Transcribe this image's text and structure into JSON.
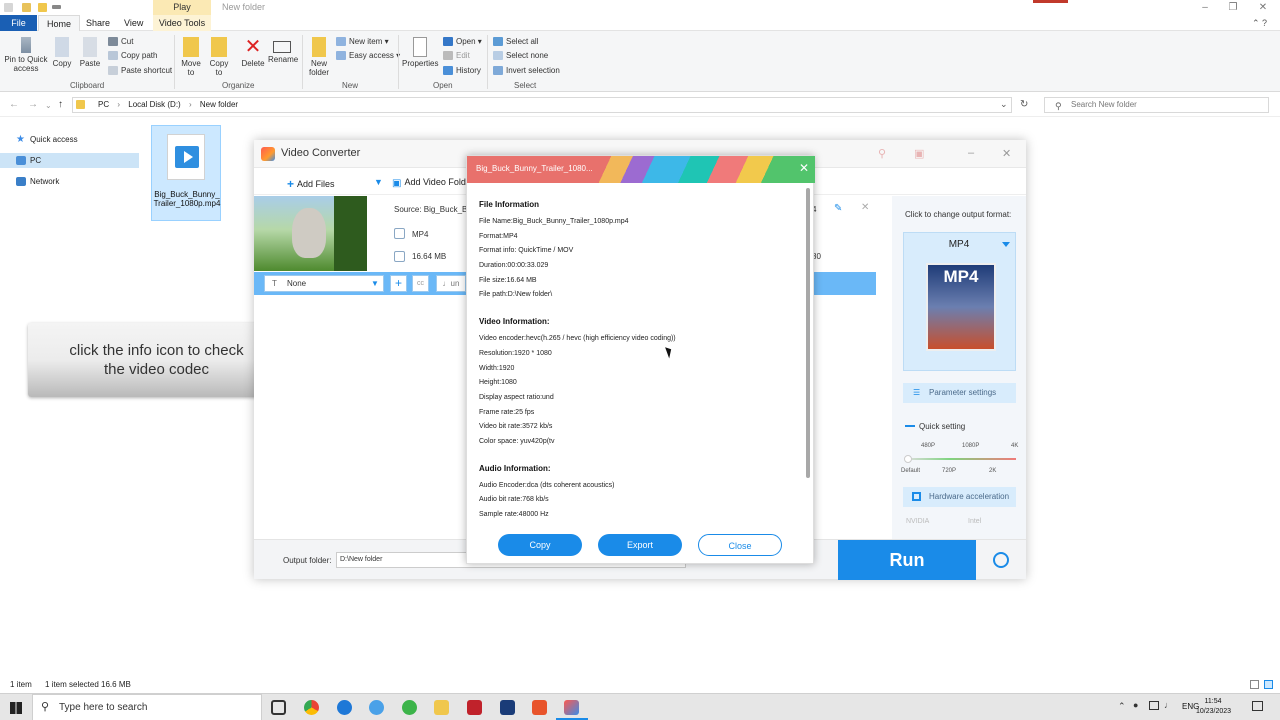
{
  "explorer": {
    "context_tab": "Play",
    "title": "New folder",
    "tabs": [
      "File",
      "Home",
      "Share",
      "View",
      "Video Tools"
    ],
    "ribbon": {
      "pin": "Pin to Quick access",
      "copy": "Copy",
      "paste": "Paste",
      "cut": "Cut",
      "copy_path": "Copy path",
      "paste_shortcut": "Paste shortcut",
      "move_to": "Move to",
      "copy_to": "Copy to",
      "delete": "Delete",
      "rename": "Rename",
      "new_folder": "New folder",
      "new_item": "New item",
      "easy_access": "Easy access",
      "properties": "Properties",
      "open": "Open",
      "edit": "Edit",
      "history": "History",
      "select_all": "Select all",
      "select_none": "Select none",
      "invert_selection": "Invert selection",
      "groups": [
        "Clipboard",
        "Organize",
        "New",
        "Open",
        "Select"
      ]
    },
    "breadcrumb": [
      "PC",
      "Local Disk (D:)",
      "New folder"
    ],
    "search_placeholder": "Search New folder",
    "nav": [
      "Quick access",
      "PC",
      "Network"
    ],
    "file_name": "Big_Buck_Bunny_Trailer_1080p.mp4",
    "status": {
      "count": "1 item",
      "selected": "1 item selected  16.6 MB"
    }
  },
  "taskbar": {
    "search_placeholder": "Type here to search",
    "lang": "ENG",
    "time": "11:54",
    "date": "10/23/2023"
  },
  "converter": {
    "title": "Video Converter",
    "add_files": "Add Files",
    "add_video_folder": "Add Video Fold",
    "source_label": "Source: Big_Buck_B",
    "format": "MP4",
    "size": "16.64 MB",
    "right_clip_1": "4",
    "right_clip_2": "80",
    "subtitle": "None",
    "audio_clip": "un",
    "output_hint": "Click to change output format:",
    "output_format": "MP4",
    "parameter_settings": "Parameter settings",
    "quick_setting": "Quick setting",
    "quality_top": [
      "480P",
      "1080P",
      "4K"
    ],
    "quality_bottom": [
      "Default",
      "720P",
      "2K"
    ],
    "hardware_acceleration": "Hardware acceleration",
    "chips": [
      "NVIDIA",
      "Intel"
    ],
    "output_folder_label": "Output folder:",
    "output_folder_value": "D:\\New folder",
    "run": "Run"
  },
  "dialog": {
    "title": "Big_Buck_Bunny_Trailer_1080...",
    "file_info_heading": "File Information",
    "file_info": [
      "File Name:Big_Buck_Bunny_Trailer_1080p.mp4",
      "Format:MP4",
      "Format info: QuickTime / MOV",
      "Duration:00:00:33.029",
      "File size:16.64 MB",
      "File path:D:\\New folder\\"
    ],
    "video_info_heading": "Video Information:",
    "video_info": [
      "Video encoder:hevc(h.265 / hevc (high efficiency video coding))",
      "Resolution:1920 * 1080",
      "Width:1920",
      "Height:1080",
      "Display aspect ratio:und",
      "Frame rate:25 fps",
      "Video bit rate:3572 kb/s",
      "Color space: yuv420p(tv"
    ],
    "audio_info_heading": "Audio Information:",
    "audio_info": [
      "Audio Encoder:dca (dts coherent acoustics)",
      "Audio bit rate:768 kb/s",
      "Sample rate:48000 Hz"
    ],
    "buttons": {
      "copy": "Copy",
      "export": "Export",
      "close": "Close"
    }
  },
  "annotation": {
    "line1": "click the info icon to check",
    "line2": "the video codec"
  },
  "colors": {
    "accent": "#1a8be8",
    "ribbon_file_tab": "#1a5fb4",
    "selection": "#cce8ff"
  }
}
